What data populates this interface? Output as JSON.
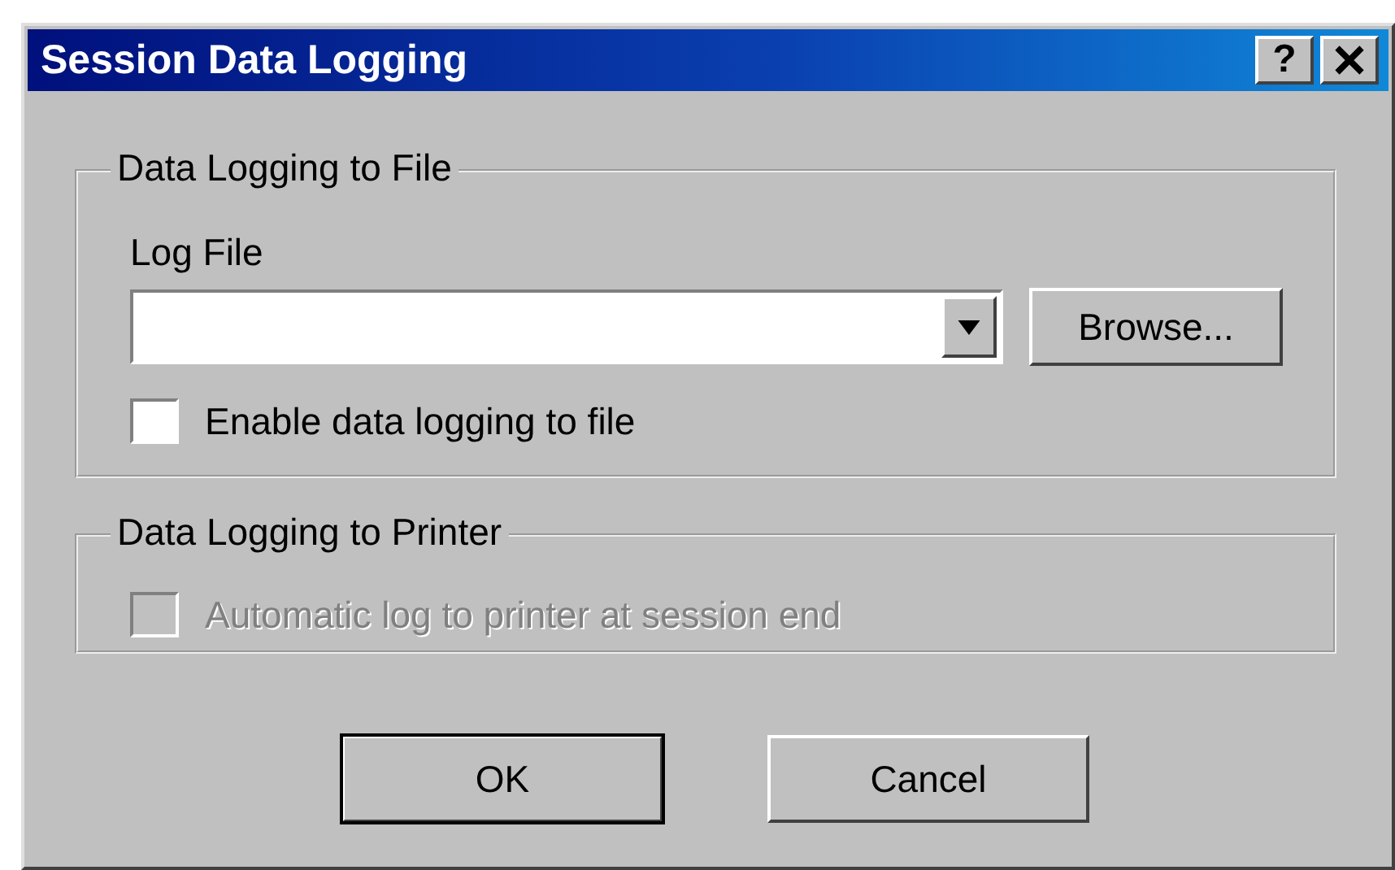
{
  "window": {
    "title": "Session Data Logging",
    "help_button": "?"
  },
  "file_group": {
    "legend": "Data Logging to File",
    "field_label": "Log File",
    "browse_button": "Browse...",
    "checkbox": {
      "label": "Enable data logging to file",
      "checked": false,
      "disabled": false
    }
  },
  "printer_group": {
    "legend": "Data Logging to Printer",
    "checkbox": {
      "label": "Automatic log to printer at session end",
      "checked": false,
      "disabled": true
    }
  },
  "buttons": [
    {
      "label": "OK",
      "default": true
    },
    {
      "label": "Cancel",
      "default": false
    }
  ]
}
